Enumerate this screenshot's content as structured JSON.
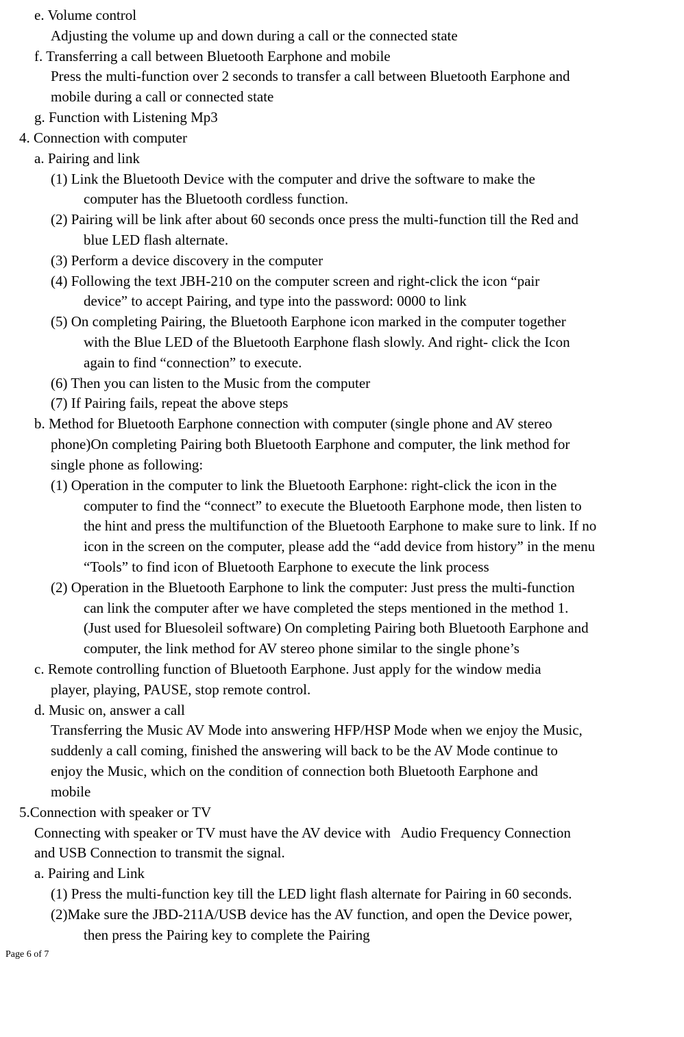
{
  "lines": {
    "e_title": "e. Volume control",
    "e_body": "Adjusting the volume up and down during a call or the connected state",
    "f_title": "f. Transferring a call between Bluetooth Earphone and mobile",
    "f_body1": "Press the multi-function over 2 seconds to transfer a call between Bluetooth Earphone and",
    "f_body2": "mobile during a call or connected state",
    "g_title": "g. Function with Listening Mp3",
    "s4_title": "4. Connection with computer",
    "s4a_title": "a. Pairing and link",
    "s4a1_l1": "(1) Link the Bluetooth Device with the computer and drive the software to make the",
    "s4a1_l2": "computer has the Bluetooth cordless function.",
    "s4a2_l1": "(2) Pairing will be link after about 60 seconds once press the multi-function till the Red and",
    "s4a2_l2": "blue LED flash alternate.",
    "s4a3": "(3) Perform a device discovery in the computer",
    "s4a4_l1": "(4) Following the text JBH-210 on the computer screen and right-click the icon “pair",
    "s4a4_l2": "device” to accept Pairing, and type into the password: 0000 to link",
    "s4a5_l1": "(5) On completing Pairing, the Bluetooth Earphone icon marked in the computer together",
    "s4a5_l2": "with the Blue LED of the Bluetooth Earphone flash slowly. And right- click the Icon",
    "s4a5_l3": "again to find “connection” to execute.",
    "s4a6": "(6) Then you can listen to the Music from the computer",
    "s4a7": "(7) If Pairing fails, repeat the above steps",
    "s4b_l1": "b. Method for Bluetooth Earphone connection with computer (single phone and AV stereo",
    "s4b_l2": "phone)On completing Pairing both Bluetooth Earphone and computer, the link method for",
    "s4b_l3": "single phone as following:",
    "s4b1_l1": "(1) Operation in the computer to link the Bluetooth Earphone: right-click the icon in the",
    "s4b1_l2": "computer to find the “connect” to execute the Bluetooth Earphone mode, then listen to",
    "s4b1_l3": "the hint and press the multifunction of the Bluetooth Earphone to make sure to link. If no",
    "s4b1_l4": "icon in the screen on the computer, please add the “add device from history” in the menu",
    "s4b1_l5": "“Tools” to find icon of Bluetooth Earphone to execute the link process",
    "s4b2_l1": "(2) Operation in the Bluetooth Earphone to link the computer: Just press the multi-function",
    "s4b2_l2": "can link the computer after we have completed the steps mentioned in the method 1.",
    "s4b2_l3": "(Just used for Bluesoleil software) On completing Pairing both Bluetooth Earphone and",
    "s4b2_l4": "computer, the link method for AV stereo phone similar to the single phone’s",
    "s4c_l1": "c. Remote controlling function of Bluetooth Earphone. Just apply for the window media",
    "s4c_l2": "player, playing, PAUSE, stop remote control.",
    "s4d_title": "d. Music on, answer a call",
    "s4d_l1": "Transferring the Music AV Mode into answering HFP/HSP Mode when we enjoy the Music,",
    "s4d_l2": "suddenly a call coming, finished the answering will back to be the AV Mode continue to",
    "s4d_l3": "enjoy the Music, which on the condition of connection both Bluetooth Earphone and",
    "s4d_l4": "mobile",
    "s5_title": "5.Connection with speaker or TV",
    "s5_intro_l1": "Connecting with speaker or TV must have the AV device with   Audio Frequency Connection",
    "s5_intro_l2": "and USB Connection to transmit the signal.",
    "s5a_title": "a. Pairing and Link",
    "s5a1": "(1) Press the multi-function key till the LED light flash alternate for Pairing in 60 seconds.",
    "s5a2_l1": "(2)Make sure the JBD-211A/USB device has the AV function, and open the Device power,",
    "s5a2_l2": "then press the Pairing key to complete the Pairing"
  },
  "footer": "Page 6 of 7"
}
